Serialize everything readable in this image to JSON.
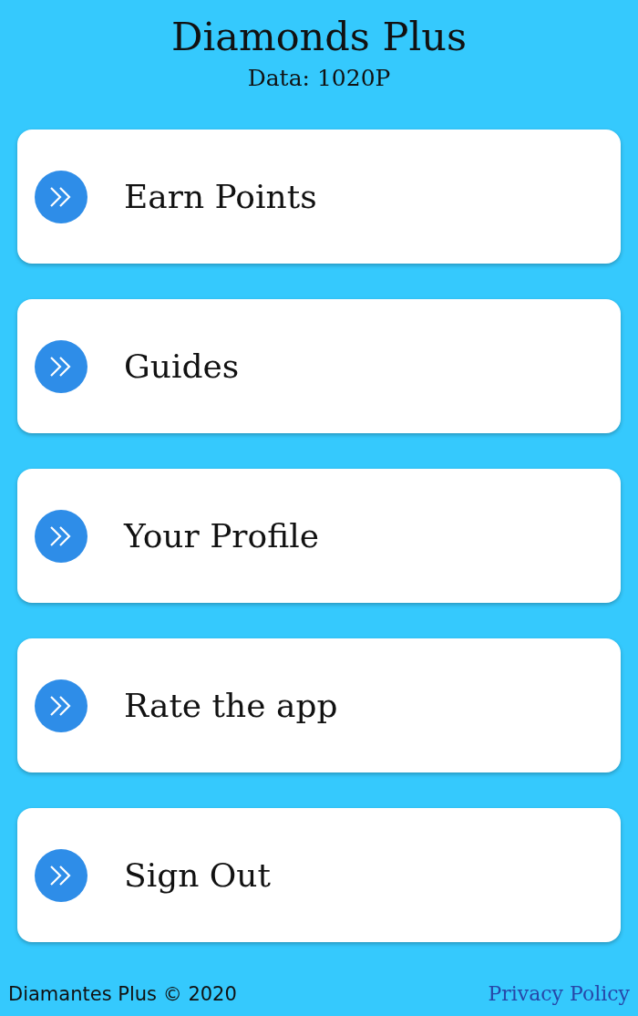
{
  "header": {
    "title": "Diamonds Plus",
    "subtitle": "Data: 1020P"
  },
  "menu": [
    {
      "label": "Earn Points"
    },
    {
      "label": "Guides"
    },
    {
      "label": "Your Profile"
    },
    {
      "label": "Rate the app"
    },
    {
      "label": "Sign Out"
    }
  ],
  "footer": {
    "copyright": "Diamantes Plus © 2020",
    "link": "Privacy Policy"
  }
}
